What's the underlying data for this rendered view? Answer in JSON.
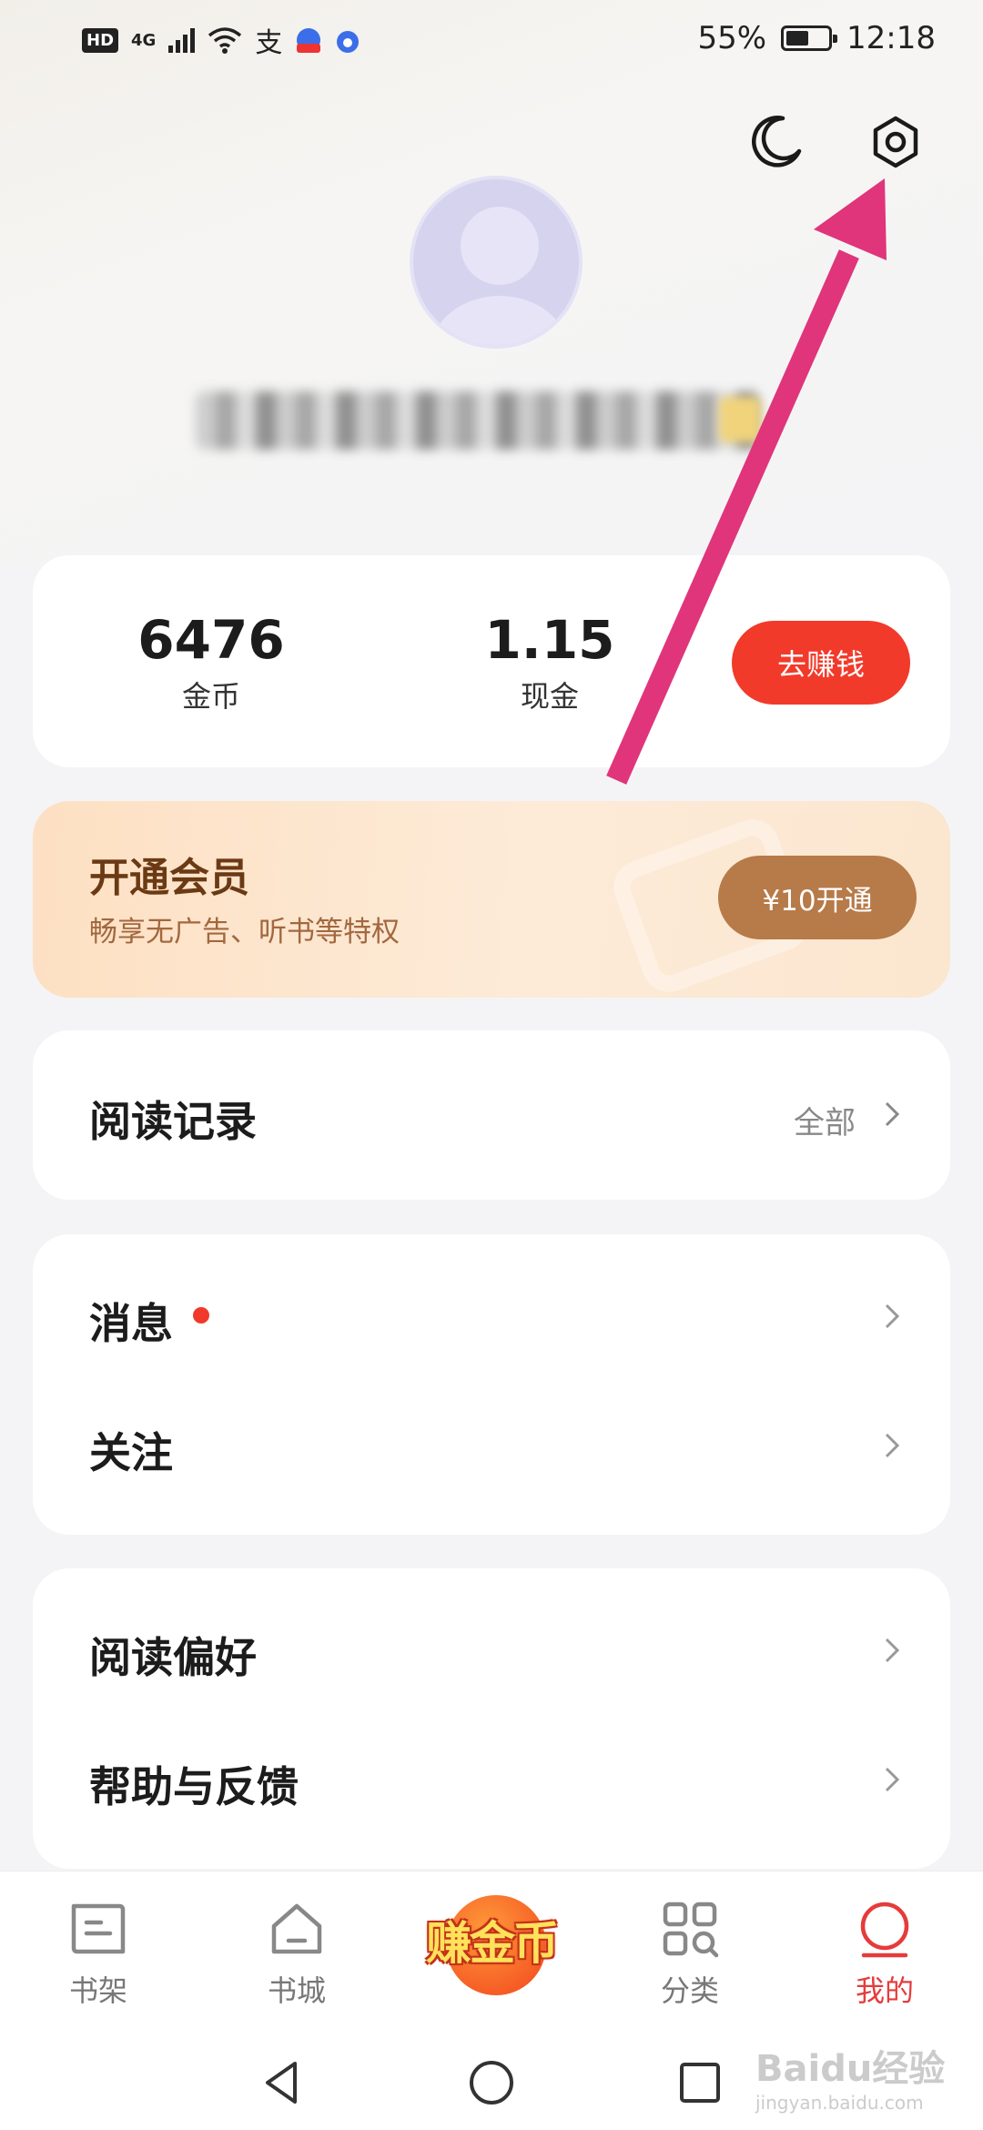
{
  "status_bar": {
    "hd": "HD",
    "network": "4G",
    "battery_text": "55%",
    "battery_level": 0.55,
    "time": "12:18",
    "app_icon": "支"
  },
  "header": {
    "moon_icon": "moon-icon",
    "settings_icon": "gear-icon"
  },
  "profile": {
    "avatar_icon": "user-avatar",
    "username_blurred": "▇▇▇▇▇▇▇▇▇▇▇▇"
  },
  "wallet": {
    "coins_value": "6476",
    "coins_label": "金币",
    "cash_value": "1.15",
    "cash_label": "现金",
    "earn_button": "去赚钱"
  },
  "vip": {
    "title": "开通会员",
    "subtitle": "畅享无广告、听书等特权",
    "button": "¥10开通"
  },
  "reading_history": {
    "title": "阅读记录",
    "all_link": "全部"
  },
  "menu_group_1": [
    {
      "label": "消息"
    },
    {
      "label": "关注"
    }
  ],
  "menu_group_2": [
    {
      "label": "阅读偏好"
    },
    {
      "label": "帮助与反馈"
    }
  ],
  "tabbar": {
    "tabs": [
      {
        "label": "书架",
        "icon": "bookshelf-icon"
      },
      {
        "label": "书城",
        "icon": "home-icon"
      },
      {
        "label": "赚金币",
        "icon": "earn-coins-icon"
      },
      {
        "label": "分类",
        "icon": "category-icon"
      },
      {
        "label": "我的",
        "icon": "profile-icon"
      }
    ],
    "active": "我的",
    "active_color": "#e63b3b"
  },
  "watermark": {
    "brand": "Baidu经验",
    "url": "jingyan.baidu.com"
  },
  "colors": {
    "accent_red": "#f23a2a",
    "vip_brown": "#b77a49",
    "annotation_arrow": "#e0357a"
  }
}
